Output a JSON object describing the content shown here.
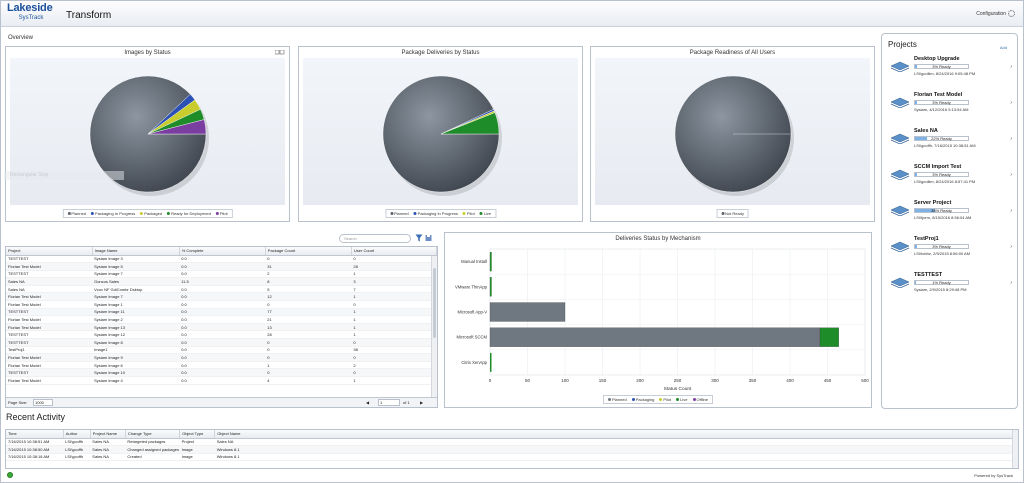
{
  "app": {
    "brand": "Lakeside",
    "product": "SysTrack",
    "title": "Transform",
    "config_label": "Configuration"
  },
  "overview_label": "Overview",
  "watermark": "Rectangular Snip",
  "charts": {
    "images_by_status": {
      "title": "Images by Status",
      "legend": [
        "Planned",
        "Packaging In Progress",
        "Packaged",
        "Ready for Deployment",
        "Pilot"
      ]
    },
    "package_deliveries": {
      "title": "Package Deliveries by Status",
      "legend": [
        "Planned",
        "Packaging In Progress",
        "Pilot",
        "Live"
      ]
    },
    "package_readiness": {
      "title": "Package Readiness of All Users",
      "legend": [
        "Not Ready"
      ]
    },
    "deliveries_mechanism": {
      "title": "Deliveries Status by Mechanism",
      "legend": [
        "Planned",
        "Packaging",
        "Pilot",
        "Live",
        "Offline"
      ]
    }
  },
  "chart_data": [
    {
      "type": "pie",
      "title": "Images by Status",
      "labels": [
        "Planned",
        "Packaging In Progress",
        "Packaged",
        "Ready for Deployment",
        "Pilot"
      ],
      "values": [
        88,
        2,
        3,
        3,
        4
      ],
      "colors": [
        "#5b6470",
        "#2d50b4",
        "#c8cd2d",
        "#1e8c28",
        "#7a3ea1"
      ]
    },
    {
      "type": "pie",
      "title": "Package Deliveries by Status",
      "labels": [
        "Planned",
        "Packaging In Progress",
        "Pilot",
        "Live"
      ],
      "values": [
        93,
        0.5,
        0.5,
        6
      ],
      "colors": [
        "#5b6470",
        "#2d50b4",
        "#c8cd2d",
        "#1e8c28"
      ]
    },
    {
      "type": "pie",
      "title": "Package Readiness of All Users",
      "labels": [
        "Not Ready"
      ],
      "values": [
        100
      ],
      "colors": [
        "#5b6470"
      ]
    },
    {
      "type": "bar",
      "orientation": "horizontal",
      "title": "Deliveries Status by Mechanism",
      "xlabel": "Status Count",
      "categories": [
        "Manual Install",
        "VMware ThinApp",
        "Microsoft App-V",
        "Microsoft SCCM",
        "Citrix XenApp"
      ],
      "xlim": [
        0,
        500
      ],
      "xticks": [
        0,
        50,
        100,
        150,
        200,
        250,
        300,
        350,
        400,
        450,
        500
      ],
      "series": [
        {
          "name": "Planned",
          "values": [
            2,
            2,
            100,
            440,
            0
          ],
          "color": "#6f7780"
        },
        {
          "name": "Packaging",
          "values": [
            0,
            0,
            0,
            0,
            0
          ],
          "color": "#2d50b4"
        },
        {
          "name": "Pilot",
          "values": [
            0,
            0,
            0,
            0,
            0
          ],
          "color": "#c8cd2d"
        },
        {
          "name": "Live",
          "values": [
            0,
            0,
            0,
            25,
            0
          ],
          "color": "#1e8c28"
        },
        {
          "name": "Offline",
          "values": [
            0,
            0,
            0,
            0,
            0
          ],
          "color": "#7a3ea1"
        }
      ]
    }
  ],
  "grid": {
    "search_placeholder": "Search",
    "columns": [
      "Project",
      "Image Name",
      "% Complete",
      "Package Count",
      "User Count"
    ],
    "rows": [
      [
        "TESTTEST",
        "Sysiam Image 3",
        "0.0",
        "0",
        "0"
      ],
      [
        "Florian Test Model",
        "Sysiam Image 5",
        "0.0",
        "31",
        "28"
      ],
      [
        "TESTTEST",
        "Sysiam Image 7",
        "0.0",
        "2",
        "1"
      ],
      [
        "Sales NA",
        "Gonzos Sales",
        "11.5",
        "8",
        "3"
      ],
      [
        "Sales NA",
        "Vcov NF GdiCombr Dsktop",
        "0.0",
        "5",
        "7"
      ],
      [
        "Florian Test Model",
        "Sysiam Image 7",
        "0.0",
        "12",
        "1"
      ],
      [
        "Florian Test Model",
        "Sysiam Image 1",
        "0.0",
        "0",
        "0"
      ],
      [
        "TESTTEST",
        "Sysiam Image 11",
        "0.0",
        "77",
        "1"
      ],
      [
        "Florian Test Model",
        "Sysiam Image 2",
        "0.0",
        "21",
        "1"
      ],
      [
        "Florian Test Model",
        "Sysiam Image 13",
        "0.0",
        "13",
        "1"
      ],
      [
        "TESTTEST",
        "Sysiam Image 12",
        "0.0",
        "28",
        "1"
      ],
      [
        "TESTTEST",
        "Sysiam Image 8",
        "0.0",
        "0",
        "0"
      ],
      [
        "TestProj1",
        "Image1",
        "0.0",
        "0",
        "38"
      ],
      [
        "Florian Test Model",
        "Sysiam Image 9",
        "0.0",
        "0",
        "0"
      ],
      [
        "Florian Test Model",
        "Sysiam Image 6",
        "0.0",
        "1",
        "2"
      ],
      [
        "TESTTEST",
        "Sysiam Image 10",
        "0.0",
        "0",
        "0"
      ],
      [
        "Florian Test Model",
        "Sysiam Image 4",
        "0.0",
        "4",
        "1"
      ]
    ],
    "footer": {
      "page_size_label": "Page Size:",
      "page_size": "1000",
      "page": "1",
      "of_label": "of 1"
    }
  },
  "projects": {
    "title": "Projects",
    "add_label": "Add",
    "items": [
      {
        "name": "Desktop Upgrade",
        "pct": 3,
        "pct_label": "3% Ready",
        "meta": "LSI\\gcollim, 8/24/2016 9:05:48 PM"
      },
      {
        "name": "Florian Test Model",
        "pct": 3,
        "pct_label": "3% Ready",
        "meta": "Sysiam, 4/12/2016 5:13:54 AM"
      },
      {
        "name": "Sales NA",
        "pct": 22,
        "pct_label": "22% Ready",
        "meta": "LSI\\gcoffh, 7/16/2015 10:38:51 AM"
      },
      {
        "name": "SCCM Import Test",
        "pct": 3,
        "pct_label": "3% Ready",
        "meta": "LSI\\gcollim, 8/24/2016 8:57:41 PM"
      },
      {
        "name": "Server Project",
        "pct": 38,
        "pct_label": "38% Ready",
        "meta": "LSI\\tjorm, 8/15/2016 8:56:04 AM"
      },
      {
        "name": "TestProj1",
        "pct": 3,
        "pct_label": "3% Ready",
        "meta": "LSI\\tobhz, 2/9/2015 8:56:00 AM"
      },
      {
        "name": "TESTTEST",
        "pct": 1,
        "pct_label": "1% Ready",
        "meta": "Sysiam, 2/9/2015 8:29:48 PM"
      }
    ]
  },
  "recent": {
    "title": "Recent Activity",
    "columns": [
      "Time",
      "Author",
      "Project Name",
      "Change Type",
      "Object Type",
      "Object Name"
    ],
    "rows": [
      [
        "7/16/2015 10:38:51 AM",
        "LSI\\gcoffh",
        "Sales NA",
        "Retargeted packages",
        "Project",
        "Sales NA"
      ],
      [
        "7/16/2015 10:38:50 AM",
        "LSI\\gcoffh",
        "Sales NA",
        "Changed assigned packages",
        "Image",
        "Windows 8.1"
      ],
      [
        "7/16/2015 10:38:18 AM",
        "LSI\\gcoffh",
        "Sales NA",
        "Created",
        "Image",
        "Windows 8.1"
      ]
    ]
  },
  "footer": {
    "powered": "Powered by SysTrack"
  }
}
